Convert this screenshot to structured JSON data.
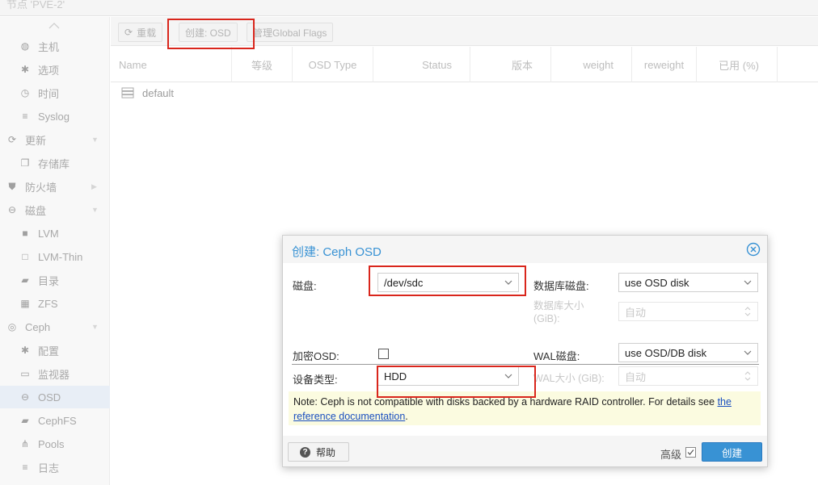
{
  "header": {
    "node_title": "节点 'PVE-2'"
  },
  "sidebar": {
    "items": [
      {
        "label": "主机",
        "icon": "globe-icon",
        "level": 1
      },
      {
        "label": "选项",
        "icon": "gear-icon",
        "level": 1
      },
      {
        "label": "时间",
        "icon": "clock-icon",
        "level": 1
      },
      {
        "label": "Syslog",
        "icon": "list-icon",
        "level": 1
      },
      {
        "label": "更新",
        "icon": "refresh-icon",
        "level": 0,
        "expandable": true
      },
      {
        "label": "存储库",
        "icon": "repository-icon",
        "level": 1
      },
      {
        "label": "防火墙",
        "icon": "shield-icon",
        "level": 0,
        "expandable": true
      },
      {
        "label": "磁盘",
        "icon": "disk-icon",
        "level": 0,
        "expandable": true
      },
      {
        "label": "LVM",
        "icon": "square-icon",
        "level": 1
      },
      {
        "label": "LVM-Thin",
        "icon": "square-outline-icon",
        "level": 1
      },
      {
        "label": "目录",
        "icon": "folder-icon",
        "level": 1
      },
      {
        "label": "ZFS",
        "icon": "grid-icon",
        "level": 1
      },
      {
        "label": "Ceph",
        "icon": "ceph-icon",
        "level": 0,
        "expandable": true
      },
      {
        "label": "配置",
        "icon": "gear-icon",
        "level": 1
      },
      {
        "label": "监视器",
        "icon": "monitor-icon",
        "level": 1
      },
      {
        "label": "OSD",
        "icon": "disk-icon",
        "level": 1,
        "active": true
      },
      {
        "label": "CephFS",
        "icon": "folder-icon",
        "level": 1
      },
      {
        "label": "Pools",
        "icon": "sitemap-icon",
        "level": 1
      },
      {
        "label": "日志",
        "icon": "list-icon",
        "level": 1
      }
    ]
  },
  "toolbar": {
    "reload_label": "重载",
    "create_osd_label": "创建: OSD",
    "global_flags_label": "管理Global Flags"
  },
  "grid": {
    "columns": [
      "Name",
      "等级",
      "OSD Type",
      "Status",
      "版本",
      "weight",
      "reweight",
      "已用 (%)"
    ],
    "rows": [
      {
        "name": "default",
        "icon": "server-icon"
      }
    ]
  },
  "dialog": {
    "title": "创建: Ceph OSD",
    "disk_label": "磁盘:",
    "disk_value": "/dev/sdc",
    "db_disk_label": "数据库磁盘:",
    "db_disk_value": "use OSD disk",
    "db_size_label": "数据库大小 (GiB):",
    "db_size_placeholder": "自动",
    "encrypt_label": "加密OSD:",
    "encrypt_checked": false,
    "wal_disk_label": "WAL磁盘:",
    "wal_disk_value": "use OSD/DB disk",
    "device_class_label": "设备类型:",
    "device_class_value": "HDD",
    "wal_size_label": "WAL大小 (GiB):",
    "wal_size_placeholder": "自动",
    "note_text": "Note: Ceph is not compatible with disks backed by a hardware RAID controller. For details see ",
    "note_link_text": "the reference documentation",
    "note_suffix": ".",
    "help_label": "帮助",
    "advanced_label": "高级",
    "advanced_checked": true,
    "create_label": "创建"
  },
  "colors": {
    "accent": "#3892d4",
    "annotation": "#d9261c",
    "note_bg": "#fbfbe0"
  }
}
